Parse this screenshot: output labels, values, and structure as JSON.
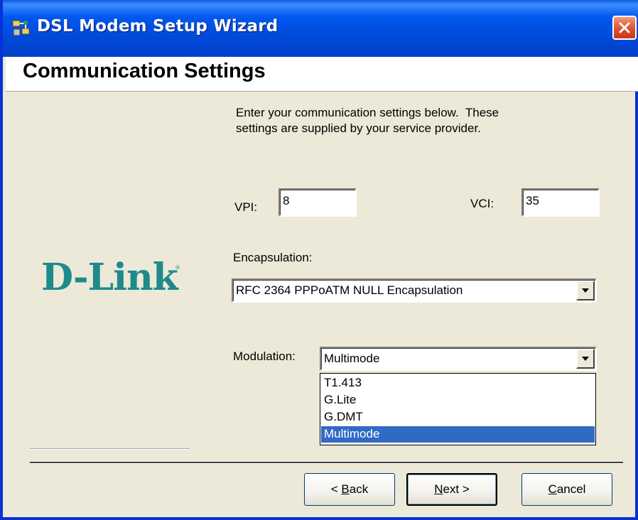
{
  "window": {
    "title": "DSL Modem Setup Wizard",
    "icon": "network-setup-icon",
    "close_icon": "close-icon"
  },
  "page": {
    "title": "Communication Settings",
    "intro_line1": "Enter your communication settings below.  These",
    "intro_line2": "settings are supplied by your service provider."
  },
  "brand": {
    "logo_text": "D-Link",
    "logo_color": "#1E8A8C"
  },
  "form": {
    "vpi_label": "VPI:",
    "vpi_value": "8",
    "vci_label": "VCI:",
    "vci_value": "35",
    "encapsulation_label": "Encapsulation:",
    "encapsulation_value": "RFC 2364 PPPoATM NULL Encapsulation",
    "modulation_label": "Modulation:",
    "modulation_value": "Multimode",
    "modulation_options": [
      "T1.413",
      "G.Lite",
      "G.DMT",
      "Multimode"
    ],
    "modulation_selected_index": 3
  },
  "buttons": {
    "back_prefix": "< ",
    "back_mnemonic": "B",
    "back_rest": "ack",
    "next_mnemonic": "N",
    "next_rest": "ext >",
    "cancel_mnemonic": "C",
    "cancel_rest": "ancel"
  },
  "colors": {
    "titlebar": "#0058EE",
    "selection": "#316AC5",
    "face": "#ECE9D8"
  }
}
